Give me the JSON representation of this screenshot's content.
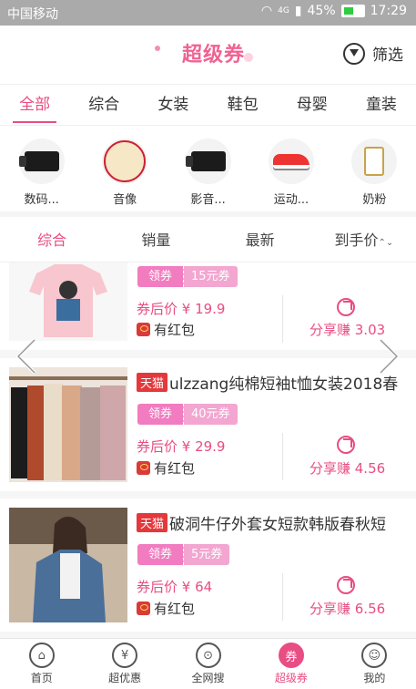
{
  "statusbar": {
    "carrier": "中国移动",
    "network": "4G",
    "battery": "45%",
    "time": "17:29"
  },
  "header": {
    "logo": "超级券",
    "filter_label": "筛选"
  },
  "tabs": [
    {
      "label": "全部"
    },
    {
      "label": "综合"
    },
    {
      "label": "女装"
    },
    {
      "label": "鞋包"
    },
    {
      "label": "母婴"
    },
    {
      "label": "童装"
    }
  ],
  "subcategories": [
    {
      "label": "数码...",
      "icon": "camcorder-icon"
    },
    {
      "label": "音像",
      "icon": "poster-icon"
    },
    {
      "label": "影音...",
      "icon": "camcorder-icon"
    },
    {
      "label": "运动...",
      "icon": "sneaker-icon"
    },
    {
      "label": "奶粉",
      "icon": "milk-powder-icon"
    }
  ],
  "sort": [
    {
      "label": "综合"
    },
    {
      "label": "销量"
    },
    {
      "label": "最新"
    },
    {
      "label": "到手价"
    }
  ],
  "sort_arrows": "⌃⌄",
  "products": [
    {
      "title": "",
      "tag": "",
      "coupon_label": "领券",
      "coupon_value": "15元券",
      "price": "券后价 ¥ 19.9",
      "redpacket": "有红包",
      "share": "分享赚 3.03"
    },
    {
      "title": "ulzzang纯棉短袖t恤女装2018春",
      "tag": "天猫",
      "coupon_label": "领券",
      "coupon_value": "40元券",
      "price": "券后价 ¥ 29.9",
      "redpacket": "有红包",
      "share": "分享赚 4.56"
    },
    {
      "title": "破洞牛仔外套女短款韩版春秋短",
      "tag": "天猫",
      "coupon_label": "领券",
      "coupon_value": "5元券",
      "price": "券后价 ¥ 64",
      "redpacket": "有红包",
      "share": "分享赚 6.56"
    }
  ],
  "bottom_nav": [
    {
      "label": "首页",
      "glyph": "⌂"
    },
    {
      "label": "超优惠",
      "glyph": "¥"
    },
    {
      "label": "全网搜",
      "glyph": "⊙"
    },
    {
      "label": "超级券",
      "glyph": "券"
    },
    {
      "label": "我的",
      "glyph": "☺"
    }
  ]
}
